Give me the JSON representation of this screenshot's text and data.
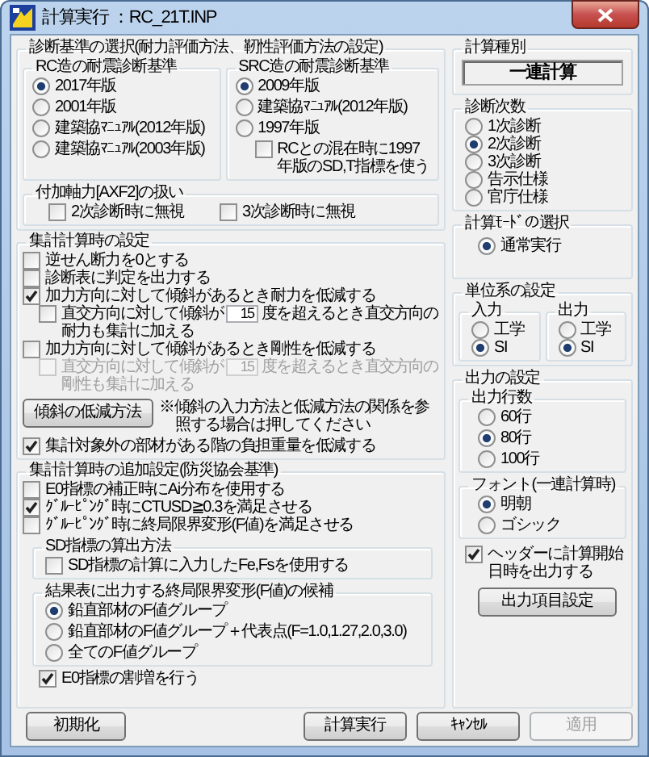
{
  "window": {
    "title": "計算実行 ：RC_21T.INP"
  },
  "criteria": {
    "label": "診断基準の選択(耐力評価方法、靭性評価方法の設定)",
    "rc": {
      "label": "RC造の耐震診断基準",
      "options": [
        {
          "label": "2017年版",
          "selected": true
        },
        {
          "label": "2001年版",
          "selected": false
        },
        {
          "label": "建築協ﾏﾆｭｱﾙ(2012年版)",
          "selected": false
        },
        {
          "label": "建築協ﾏﾆｭｱﾙ(2003年版)",
          "selected": false
        }
      ]
    },
    "src": {
      "label": "SRC造の耐震診断基準",
      "options": [
        {
          "label": "2009年版",
          "selected": true
        },
        {
          "label": "建築協ﾏﾆｭｱﾙ(2012年版)",
          "selected": false
        },
        {
          "label": "1997年版",
          "selected": false
        }
      ],
      "mixed_check": {
        "label": "RCとの混在時に1997年版のSD,T指標を使う",
        "checked": false
      }
    },
    "axf2": {
      "label": "付加軸力[AXF2]の扱い",
      "checks": [
        {
          "label": "2次診断時に無視",
          "checked": false
        },
        {
          "label": "3次診断時に無視",
          "checked": false
        }
      ]
    }
  },
  "aggregation": {
    "label": "集計計算時の設定",
    "items": [
      {
        "kind": "check",
        "label": "逆せん断力を0とする",
        "checked": false,
        "disabled": false
      },
      {
        "kind": "check",
        "label": "診断表に判定を出力する",
        "checked": false,
        "disabled": false
      },
      {
        "kind": "check",
        "label": "加力方向に対して傾斜があるとき耐力を低減する",
        "checked": true,
        "disabled": false
      },
      {
        "kind": "angle",
        "before": "直交方向に対して傾斜が",
        "value": "15",
        "after": "度を超えるとき直交方向の",
        "after_2": "耐力も集計に加える",
        "checked": false,
        "disabled": false
      },
      {
        "kind": "check",
        "label": "加力方向に対して傾斜があるとき剛性を低減する",
        "checked": false,
        "disabled": false
      },
      {
        "kind": "angle",
        "before": "直交方向に対して傾斜が",
        "value": "15",
        "after": "度を超えるとき直交方向の",
        "after_2": "剛性も集計に加える",
        "checked": false,
        "disabled": true
      }
    ],
    "method_button": "傾斜の低減方法",
    "note": "※傾斜の入力方法と低減方法の関係を参照する場合は押してください",
    "last_check": {
      "label": "集計対象外の部材がある階の負担重量を低減する",
      "checked": true
    }
  },
  "additional": {
    "label": "集計計算時の追加設定(防災協会基準)",
    "checks": [
      {
        "label": "E0指標の補正時にAi分布を使用する",
        "checked": false
      },
      {
        "label": "ｸﾞﾙｰﾋﾟﾝｸﾞ時にCTUSD≧0.3を満足させる",
        "checked": true
      },
      {
        "label": "ｸﾞﾙｰﾋﾟﾝｸﾞ時に終局限界変形(F値)を満足させる",
        "checked": false
      }
    ],
    "sd": {
      "label": "SD指標の算出方法",
      "check": {
        "label": "SD指標の計算に入力したFe,Fsを使用する",
        "checked": false
      }
    },
    "f_candidates": {
      "label": "結果表に出力する終局限界変形(F値)の候補",
      "options": [
        {
          "label": "鉛直部材のF値グループ",
          "selected": true
        },
        {
          "label": "鉛直部材のF値グループ＋代表点(F=1.0,1.27,2.0,3.0)",
          "selected": false
        },
        {
          "label": "全てのF値グループ",
          "selected": false
        }
      ]
    },
    "e0_check": {
      "label": "E0指標の割増を行う",
      "checked": true
    }
  },
  "calc_type": {
    "label": "計算種別",
    "value": "一連計算"
  },
  "diagnosis_level": {
    "label": "診断次数",
    "options": [
      {
        "label": "1次診断",
        "selected": false
      },
      {
        "label": "2次診断",
        "selected": true
      },
      {
        "label": "3次診断",
        "selected": false
      },
      {
        "label": "告示仕様",
        "selected": false
      },
      {
        "label": "官庁仕様",
        "selected": false
      }
    ]
  },
  "calc_mode": {
    "label": "計算ﾓｰﾄﾞの選択",
    "options": [
      {
        "label": "通常実行",
        "selected": true
      }
    ]
  },
  "units": {
    "label": "単位系の設定",
    "input": {
      "label": "入力",
      "options": [
        {
          "label": "工学",
          "selected": false
        },
        {
          "label": "SI",
          "selected": true
        }
      ]
    },
    "output": {
      "label": "出力",
      "options": [
        {
          "label": "工学",
          "selected": false
        },
        {
          "label": "SI",
          "selected": true
        }
      ]
    }
  },
  "output": {
    "label": "出力の設定",
    "rows": {
      "label": "出力行数",
      "options": [
        {
          "label": "60行",
          "selected": false
        },
        {
          "label": "80行",
          "selected": true
        },
        {
          "label": "100行",
          "selected": false
        }
      ]
    },
    "font": {
      "label": "フォント(一連計算時)",
      "options": [
        {
          "label": "明朝",
          "selected": true
        },
        {
          "label": "ゴシック",
          "selected": false
        }
      ]
    },
    "header_check": {
      "label": "ヘッダーに計算開始日時を出力する",
      "checked": true
    },
    "items_button": "出力項目設定"
  },
  "buttons": {
    "reset": "初期化",
    "actions": [
      {
        "label": "計算実行",
        "disabled": false
      },
      {
        "label": "ｷｬﾝｾﾙ",
        "disabled": false
      },
      {
        "label": "適用",
        "disabled": true
      }
    ]
  }
}
